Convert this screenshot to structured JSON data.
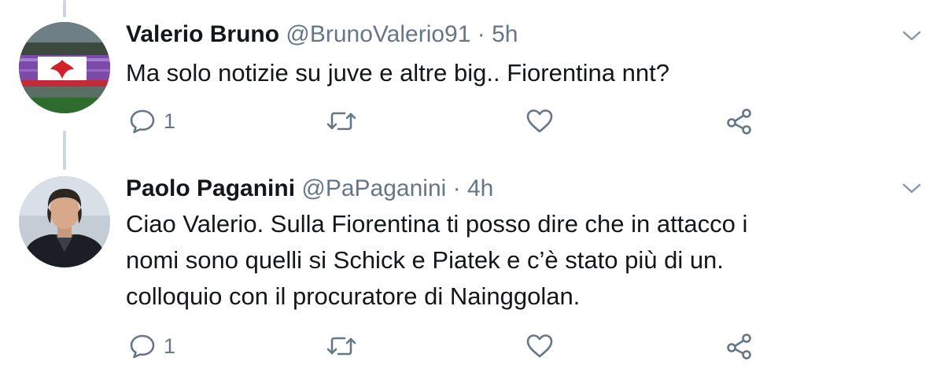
{
  "tweets": [
    {
      "name": "Valerio Bruno",
      "handle": "@BrunoValerio91",
      "separator": "·",
      "time": "5h",
      "text": "Ma solo notizie su juve e altre big.. Fiorentina nnt?",
      "reply_count": "1"
    },
    {
      "name": "Paolo Paganini",
      "handle": "@PaPaganini",
      "separator": "·",
      "time": "4h",
      "text_lines": [
        "Ciao Valerio. Sulla Fiorentina ti posso dire che in attacco i",
        "nomi sono quelli si Schick e Piatek e c’è stato più di un.",
        "colloquio con il procuratore di Nainggolan."
      ],
      "reply_count": "1"
    }
  ],
  "icons": {
    "reply": "reply-icon",
    "retweet": "retweet-icon",
    "like": "heart-icon",
    "share": "share-icon",
    "more": "chevron-down-icon"
  },
  "colors": {
    "text": "#14171a",
    "secondary": "#657786",
    "thread_line": "#ccd6dd"
  }
}
